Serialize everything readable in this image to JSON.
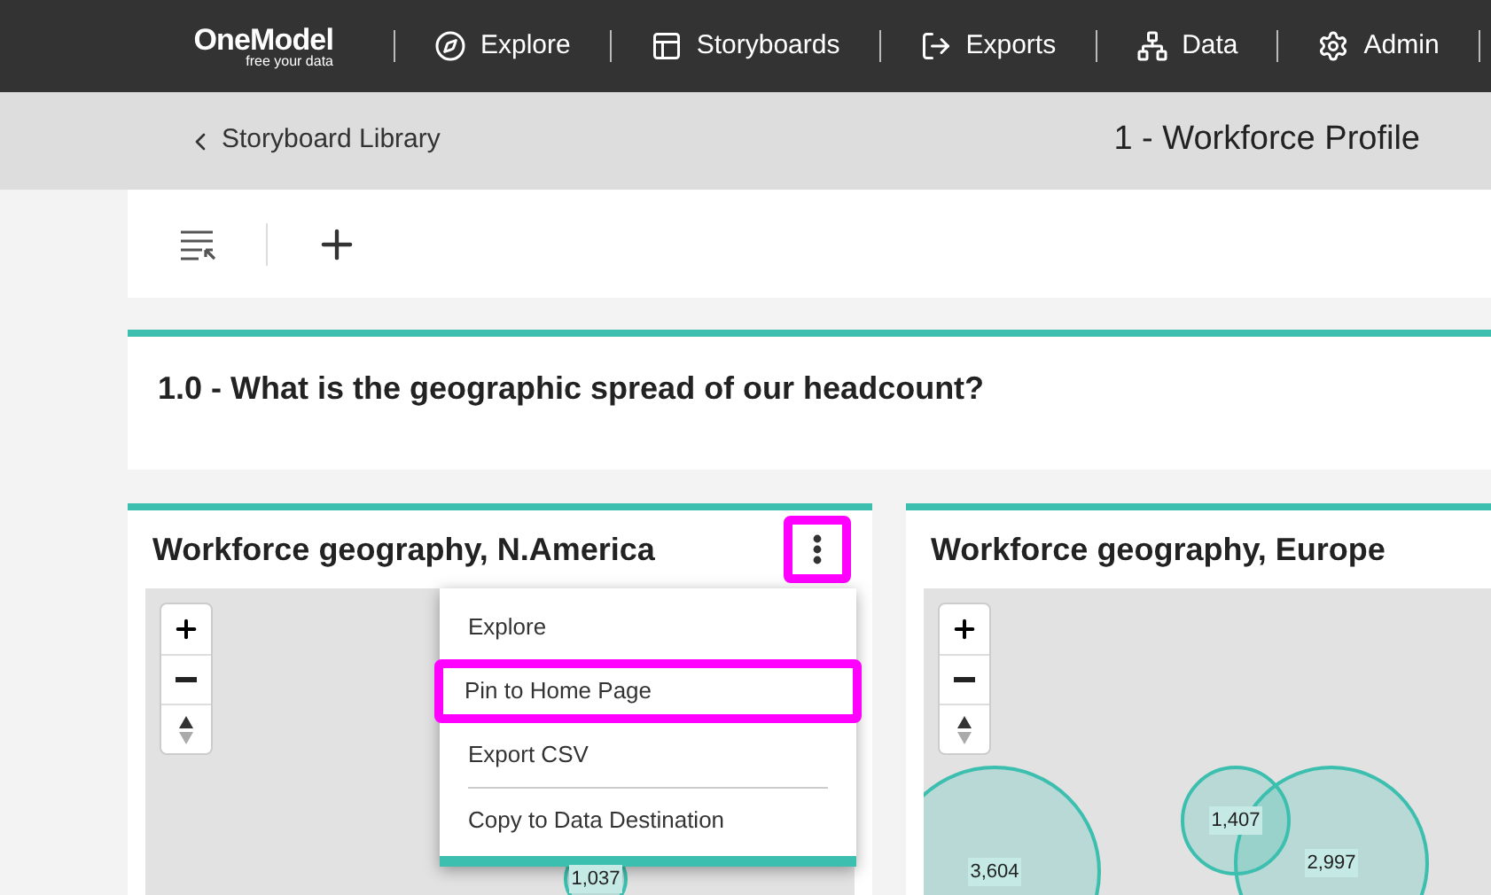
{
  "nav": {
    "logo": "OneModel",
    "tagline": "free your data",
    "items": [
      {
        "label": "Explore"
      },
      {
        "label": "Storyboards"
      },
      {
        "label": "Exports"
      },
      {
        "label": "Data"
      },
      {
        "label": "Admin"
      }
    ]
  },
  "header": {
    "back": "Storyboard Library",
    "title": "1 - Workforce Profile"
  },
  "question": "1.0 - What is the geographic spread of our headcount?",
  "menu_button": {
    "highlighted": true
  },
  "cards": [
    {
      "title": "Workforce geography, N.America",
      "bubbles": [
        "1,037"
      ]
    },
    {
      "title": "Workforce geography, Europe",
      "bubbles": [
        "3,604",
        "1,407",
        "2,997"
      ]
    }
  ],
  "menu": {
    "items": [
      {
        "label": "Explore",
        "highlighted": false,
        "divider_before": false
      },
      {
        "label": "Pin to Home Page",
        "highlighted": true,
        "divider_before": false
      },
      {
        "label": "Export CSV",
        "highlighted": false,
        "divider_before": false
      },
      {
        "label": "Copy to Data Destination",
        "highlighted": false,
        "divider_before": true
      }
    ]
  }
}
